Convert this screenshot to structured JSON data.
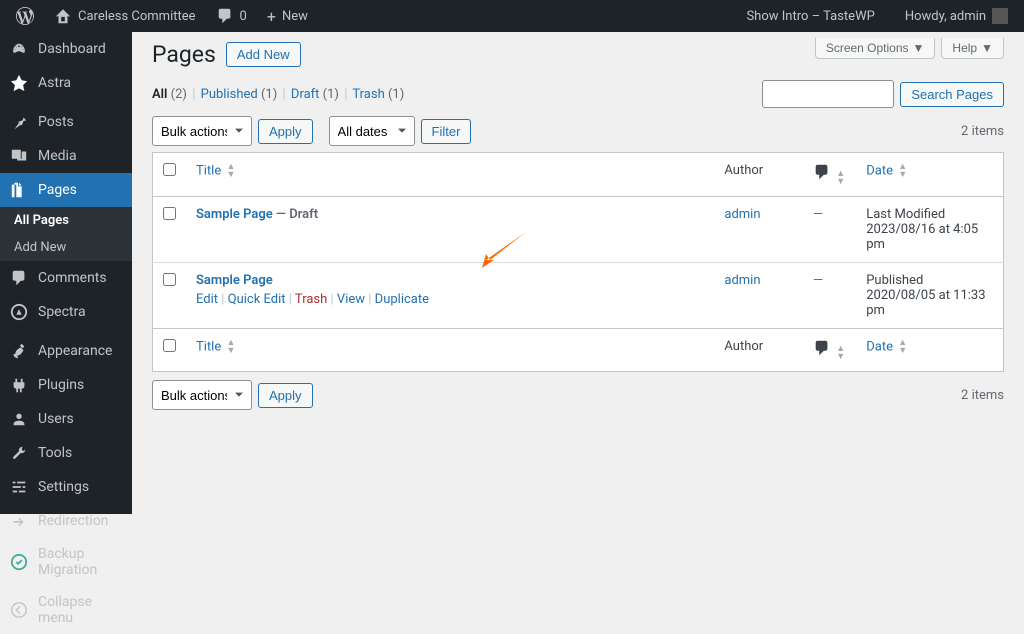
{
  "adminbar": {
    "site_name": "Careless Committee",
    "comments_count": "0",
    "new_label": "New",
    "show_intro": "Show Intro – TasteWP",
    "howdy": "Howdy, admin"
  },
  "sidebar": {
    "dashboard": "Dashboard",
    "astra": "Astra",
    "posts": "Posts",
    "media": "Media",
    "pages": "Pages",
    "pages_sub_all": "All Pages",
    "pages_sub_add": "Add New",
    "comments": "Comments",
    "spectra": "Spectra",
    "appearance": "Appearance",
    "plugins": "Plugins",
    "users": "Users",
    "tools": "Tools",
    "settings": "Settings",
    "redirection": "Redirection",
    "backup_migration": "Backup Migration",
    "collapse": "Collapse menu"
  },
  "screen": {
    "screen_options": "Screen Options",
    "help": "Help"
  },
  "header": {
    "title": "Pages",
    "add_new": "Add New"
  },
  "filters": {
    "all_label": "All",
    "all_count": "(2)",
    "published_label": "Published",
    "published_count": "(1)",
    "draft_label": "Draft",
    "draft_count": "(1)",
    "trash_label": "Trash",
    "trash_count": "(1)"
  },
  "search": {
    "button": "Search Pages"
  },
  "bulk": {
    "label": "Bulk actions",
    "apply": "Apply",
    "all_dates": "All dates",
    "filter": "Filter",
    "items_count": "2 items"
  },
  "cols": {
    "title": "Title",
    "author": "Author",
    "date": "Date"
  },
  "rows": [
    {
      "title": "Sample Page",
      "state": " — Draft",
      "author": "admin",
      "comments": "—",
      "date_status": "Last Modified",
      "date_value": "2023/08/16 at 4:05 pm"
    },
    {
      "title": "Sample Page",
      "state": "",
      "author": "admin",
      "comments": "—",
      "date_status": "Published",
      "date_value": "2020/08/05 at 11:33 pm"
    }
  ],
  "row_actions": {
    "edit": "Edit",
    "quick_edit": "Quick Edit",
    "trash": "Trash",
    "view": "View",
    "duplicate": "Duplicate"
  }
}
